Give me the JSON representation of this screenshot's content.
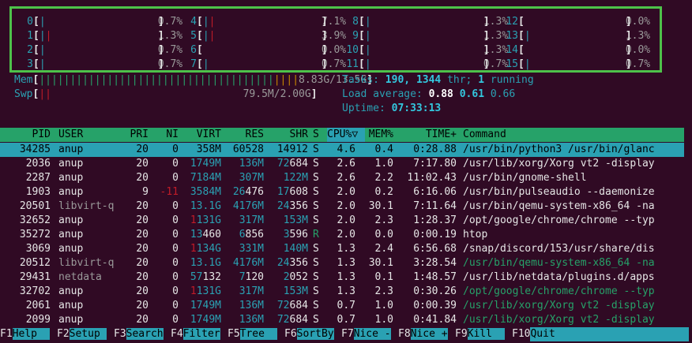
{
  "cpus": [
    {
      "id": "0",
      "bar": "|",
      "pct": "0.7%"
    },
    {
      "id": "1",
      "bar": "||",
      "pct": "1.3%"
    },
    {
      "id": "2",
      "bar": "|",
      "pct": "0.7%"
    },
    {
      "id": "3",
      "bar": "|",
      "pct": "0.7%"
    },
    {
      "id": "4",
      "bar": "||",
      "pct": "7.1%"
    },
    {
      "id": "5",
      "bar": "||",
      "pct": "3.9%"
    },
    {
      "id": "6",
      "bar": "",
      "pct": "0.0%"
    },
    {
      "id": "7",
      "bar": "|",
      "pct": "0.7%"
    },
    {
      "id": "8",
      "bar": "|",
      "pct": "1.3%"
    },
    {
      "id": "9",
      "bar": "|",
      "pct": "1.3%"
    },
    {
      "id": "10",
      "bar": "|",
      "pct": "1.3%"
    },
    {
      "id": "11",
      "bar": "|",
      "pct": "0.7%"
    },
    {
      "id": "12",
      "bar": "",
      "pct": "0.0%"
    },
    {
      "id": "13",
      "bar": "|",
      "pct": "1.3%"
    },
    {
      "id": "14",
      "bar": "",
      "pct": "0.0%"
    },
    {
      "id": "15",
      "bar": "|",
      "pct": "0.7%"
    }
  ],
  "mem": {
    "label": "Mem",
    "bar": "|||||||||||||||||||||||||||||||||||||||||||||",
    "value": "8.83G/13.5G"
  },
  "swp": {
    "label": "Swp",
    "bar": "||",
    "value": "79.5M/2.00G"
  },
  "tasks": {
    "label": "Tasks:",
    "procs": "190,",
    "threads": "1344",
    "thr_label": "thr;",
    "running": "1",
    "running_label": "running"
  },
  "load": {
    "label": "Load average:",
    "l1": "0.88",
    "l5": "0.61",
    "l15": "0.66"
  },
  "uptime": {
    "label": "Uptime:",
    "value": "07:33:13"
  },
  "headers": {
    "pid": "PID",
    "user": "USER",
    "pri": "PRI",
    "ni": "NI",
    "virt": "VIRT",
    "res": "RES",
    "shr": "SHR",
    "s": "S",
    "cpu": "CPU%",
    "sort": "▽",
    "mem": "MEM%",
    "time": "TIME+",
    "cmd": "Command"
  },
  "processes": [
    {
      "pid": "34285",
      "user": "anup",
      "pri": "20",
      "ni": "0",
      "virt": "358M",
      "res": "60528",
      "shr": "14912",
      "s": "S",
      "cpu": "4.6",
      "mem": "0.4",
      "time": "0:28.88",
      "cmd": "/usr/bin/python3 /usr/bin/glanc"
    },
    {
      "pid": "2036",
      "user": "anup",
      "pri": "20",
      "ni": "0",
      "virt": "1749M",
      "res": "136M",
      "shr": "72684",
      "s": "S",
      "cpu": "2.6",
      "mem": "1.0",
      "time": "7:17.80",
      "cmd": "/usr/lib/xorg/Xorg vt2 -display"
    },
    {
      "pid": "2287",
      "user": "anup",
      "pri": "20",
      "ni": "0",
      "virt": "7184M",
      "res": "307M",
      "shr": "122M",
      "s": "S",
      "cpu": "2.6",
      "mem": "2.2",
      "time": "11:02.43",
      "cmd": "/usr/bin/gnome-shell"
    },
    {
      "pid": "1903",
      "user": "anup",
      "pri": "9",
      "ni": "-11",
      "virt": "3584M",
      "res": "26476",
      "shr": "17608",
      "s": "S",
      "cpu": "2.0",
      "mem": "0.2",
      "time": "6:16.06",
      "cmd": "/usr/bin/pulseaudio --daemonize"
    },
    {
      "pid": "20501",
      "user": "libvirt-q",
      "pri": "20",
      "ni": "0",
      "virt": "13.1G",
      "res": "4176M",
      "shr": "24356",
      "s": "S",
      "cpu": "2.0",
      "mem": "30.1",
      "time": "7:11.64",
      "cmd": "/usr/bin/qemu-system-x86_64 -na"
    },
    {
      "pid": "32652",
      "user": "anup",
      "pri": "20",
      "ni": "0",
      "virt": "1131G",
      "res": "317M",
      "shr": "153M",
      "s": "S",
      "cpu": "2.0",
      "mem": "2.3",
      "time": "1:28.37",
      "cmd": "/opt/google/chrome/chrome --typ"
    },
    {
      "pid": "35272",
      "user": "anup",
      "pri": "20",
      "ni": "0",
      "virt": "13460",
      "res": "6856",
      "shr": "3596",
      "s": "R",
      "cpu": "2.0",
      "mem": "0.0",
      "time": "0:00.19",
      "cmd": "htop"
    },
    {
      "pid": "3069",
      "user": "anup",
      "pri": "20",
      "ni": "0",
      "virt": "1134G",
      "res": "331M",
      "shr": "140M",
      "s": "S",
      "cpu": "1.3",
      "mem": "2.4",
      "time": "6:56.68",
      "cmd": "/snap/discord/153/usr/share/dis"
    },
    {
      "pid": "20512",
      "user": "libvirt-q",
      "pri": "20",
      "ni": "0",
      "virt": "13.1G",
      "res": "4176M",
      "shr": "24356",
      "s": "S",
      "cpu": "1.3",
      "mem": "30.1",
      "time": "3:28.54",
      "cmd": "/usr/bin/qemu-system-x86_64 -na"
    },
    {
      "pid": "29431",
      "user": "netdata",
      "pri": "20",
      "ni": "0",
      "virt": "57132",
      "res": "7120",
      "shr": "2052",
      "s": "S",
      "cpu": "1.3",
      "mem": "0.1",
      "time": "1:48.57",
      "cmd": "/usr/lib/netdata/plugins.d/apps"
    },
    {
      "pid": "32702",
      "user": "anup",
      "pri": "20",
      "ni": "0",
      "virt": "1131G",
      "res": "317M",
      "shr": "153M",
      "s": "S",
      "cpu": "1.3",
      "mem": "2.3",
      "time": "0:30.26",
      "cmd": "/opt/google/chrome/chrome --typ"
    },
    {
      "pid": "2061",
      "user": "anup",
      "pri": "20",
      "ni": "0",
      "virt": "1749M",
      "res": "136M",
      "shr": "72684",
      "s": "S",
      "cpu": "0.7",
      "mem": "1.0",
      "time": "0:00.39",
      "cmd": "/usr/lib/xorg/Xorg vt2 -display"
    },
    {
      "pid": "2099",
      "user": "anup",
      "pri": "20",
      "ni": "0",
      "virt": "1749M",
      "res": "136M",
      "shr": "72684",
      "s": "S",
      "cpu": "0.7",
      "mem": "1.0",
      "time": "0:41.84",
      "cmd": "/usr/lib/xorg/Xorg vt2 -display"
    }
  ],
  "fkeys": [
    {
      "num": "F1",
      "label": "Help  "
    },
    {
      "num": "F2",
      "label": "Setup "
    },
    {
      "num": "F3",
      "label": "Search"
    },
    {
      "num": "F4",
      "label": "Filter"
    },
    {
      "num": "F5",
      "label": "Tree  "
    },
    {
      "num": "F6",
      "label": "SortBy"
    },
    {
      "num": "F7",
      "label": "Nice -"
    },
    {
      "num": "F8",
      "label": "Nice +"
    },
    {
      "num": "F9",
      "label": "Kill  "
    },
    {
      "num": "F10",
      "label": "Quit"
    }
  ]
}
